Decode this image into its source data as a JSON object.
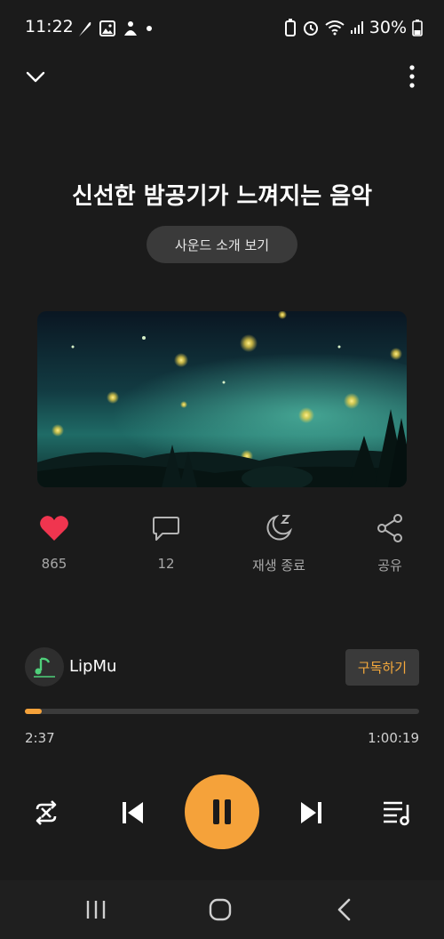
{
  "status": {
    "time": "11:22",
    "battery": "30%"
  },
  "track": {
    "title": "신선한 밤공기가 느껴지는 음악",
    "sound_intro_label": "사운드 소개 보기"
  },
  "actions": {
    "like_count": "865",
    "comment_count": "12",
    "sleep_timer_label": "재생 종료",
    "share_label": "공유"
  },
  "channel": {
    "name": "LipMu",
    "subscribe_label": "구독하기"
  },
  "player": {
    "current_time": "2:37",
    "total_time": "1:00:19",
    "progress_fraction": 0.043
  },
  "colors": {
    "accent": "#f5a23a",
    "like": "#f0354f",
    "background": "#1b1b1b"
  }
}
